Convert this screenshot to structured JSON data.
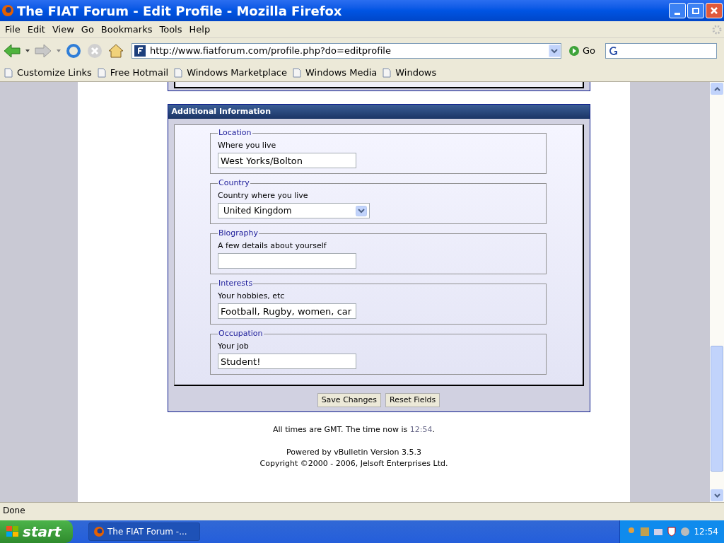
{
  "window": {
    "title": "The FIAT Forum - Edit Profile - Mozilla Firefox"
  },
  "menu": [
    "File",
    "Edit",
    "View",
    "Go",
    "Bookmarks",
    "Tools",
    "Help"
  ],
  "address": {
    "url": "http://www.fiatforum.com/profile.php?do=editprofile",
    "go": "Go"
  },
  "bookmarks": [
    "Customize Links",
    "Free Hotmail",
    "Windows Marketplace",
    "Windows Media",
    "Windows"
  ],
  "panel": {
    "title": "Additional Information",
    "fieldsets": [
      {
        "legend": "Location",
        "label": "Where you live",
        "kind": "text",
        "value": "West Yorks/Bolton"
      },
      {
        "legend": "Country",
        "label": "Country where you live",
        "kind": "select",
        "value": "United Kingdom"
      },
      {
        "legend": "Biography",
        "label": "A few details about yourself",
        "kind": "text"
      },
      {
        "legend": "Interests",
        "label": "Your hobbies, etc",
        "kind": "text",
        "value": "Football, Rugby, women, car"
      },
      {
        "legend": "Occupation",
        "label": "Your job",
        "kind": "text",
        "value": "Student!"
      }
    ],
    "buttons": [
      "Save Changes",
      "Reset Fields"
    ]
  },
  "footer": {
    "time_prefix": "All times are GMT. The time now is",
    "time": "12:54",
    "time_suffix": ".",
    "powered": "Powered by vBulletin Version 3.5.3",
    "copyright": "Copyright ©2000 - 2006, Jelsoft Enterprises Ltd."
  },
  "status_bar": "Done",
  "taskbar": {
    "start": "start",
    "task": "The FIAT Forum -...",
    "clock": "12:54"
  }
}
